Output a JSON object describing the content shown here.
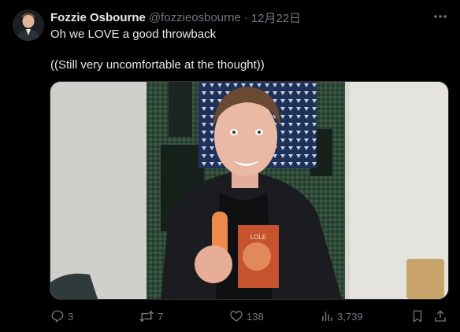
{
  "author": {
    "display_name": "Fozzie Osbourne",
    "handle": "@fozzieosbourne",
    "separator": "·",
    "date": "12月22日"
  },
  "tweet": {
    "line1": "Oh we LOVE a good throwback",
    "line2": "((Still very uncomfortable at the thought))"
  },
  "media": {
    "shirt_text": "LOLE"
  },
  "actions": {
    "replies": "3",
    "reposts": "7",
    "likes": "138",
    "views": "3,739"
  },
  "icons": [
    "more-icon",
    "reply-icon",
    "repost-icon",
    "like-icon",
    "views-icon",
    "bookmark-icon",
    "share-icon"
  ],
  "colors": {
    "background": "#000000",
    "text_primary": "#e7e9ea",
    "text_secondary": "#71767b"
  }
}
